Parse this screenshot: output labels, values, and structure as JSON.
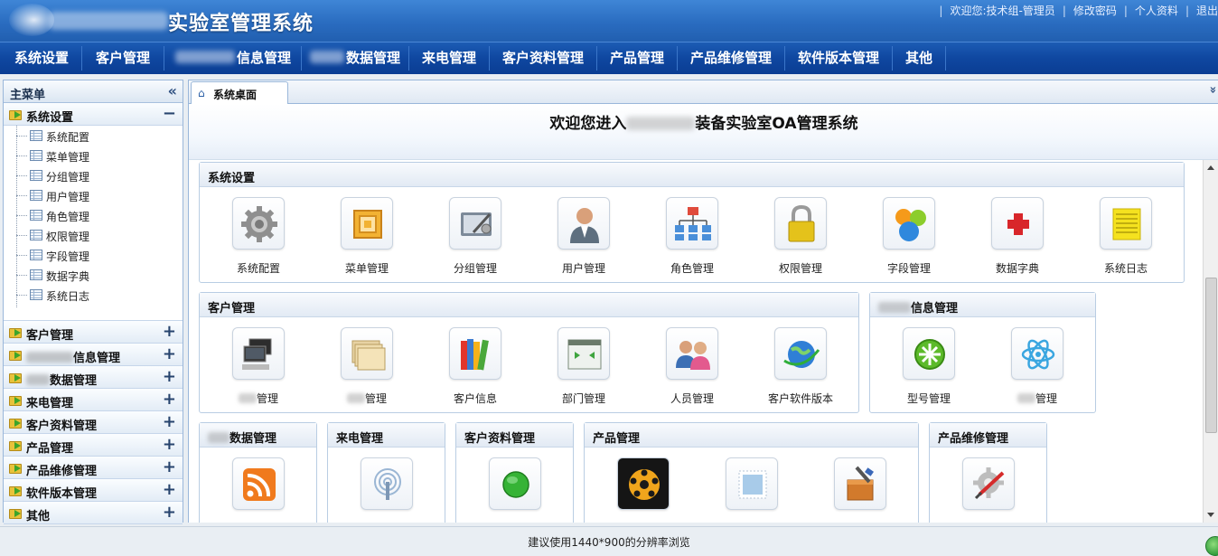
{
  "header": {
    "title": "实验室管理系统",
    "toplinks": [
      "欢迎您:技术组-管理员",
      "修改密码",
      "个人资料",
      "退出"
    ]
  },
  "nav": {
    "items": [
      "系统设置",
      "客户管理",
      "信息管理",
      "数据管理",
      "来电管理",
      "客户资料管理",
      "产品管理",
      "产品维修管理",
      "软件版本管理",
      "其他"
    ]
  },
  "sidebar": {
    "title": "主菜单",
    "collapse_icon": "«",
    "expanded_group": {
      "label": "系统设置",
      "sign": "−",
      "items": [
        "系统配置",
        "菜单管理",
        "分组管理",
        "用户管理",
        "角色管理",
        "权限管理",
        "字段管理",
        "数据字典",
        "系统日志"
      ]
    },
    "groups": [
      {
        "label": "客户管理",
        "sign": "+"
      },
      {
        "label": "信息管理",
        "sign": "+"
      },
      {
        "label": "数据管理",
        "sign": "+"
      },
      {
        "label": "来电管理",
        "sign": "+"
      },
      {
        "label": "客户资料管理",
        "sign": "+"
      },
      {
        "label": "产品管理",
        "sign": "+"
      },
      {
        "label": "产品维修管理",
        "sign": "+"
      },
      {
        "label": "软件版本管理",
        "sign": "+"
      },
      {
        "label": "其他",
        "sign": "+"
      }
    ]
  },
  "tabs": {
    "active": "系统桌面",
    "home_icon": "⌂",
    "more_icon": "»"
  },
  "welcome": {
    "prefix": "欢迎您进入",
    "suffix": "装备实验室OA管理系统"
  },
  "panels": {
    "system": {
      "title": "系统设置",
      "tiles": [
        "系统配置",
        "菜单管理",
        "分组管理",
        "用户管理",
        "角色管理",
        "权限管理",
        "字段管理",
        "数据字典",
        "系统日志"
      ]
    },
    "customer": {
      "title": "客户管理",
      "tiles": [
        "管理",
        "管理",
        "客户信息",
        "部门管理",
        "人员管理",
        "客户软件版本"
      ]
    },
    "info": {
      "title": "信息管理",
      "tiles": [
        "型号管理",
        "管理"
      ]
    },
    "data": {
      "title": "数据管理"
    },
    "calls": {
      "title": "来电管理"
    },
    "customer_data": {
      "title": "客户资料管理"
    },
    "product": {
      "title": "产品管理"
    },
    "repair": {
      "title": "产品维修管理"
    }
  },
  "footer": {
    "text": "建议使用1440*900的分辨率浏览"
  }
}
